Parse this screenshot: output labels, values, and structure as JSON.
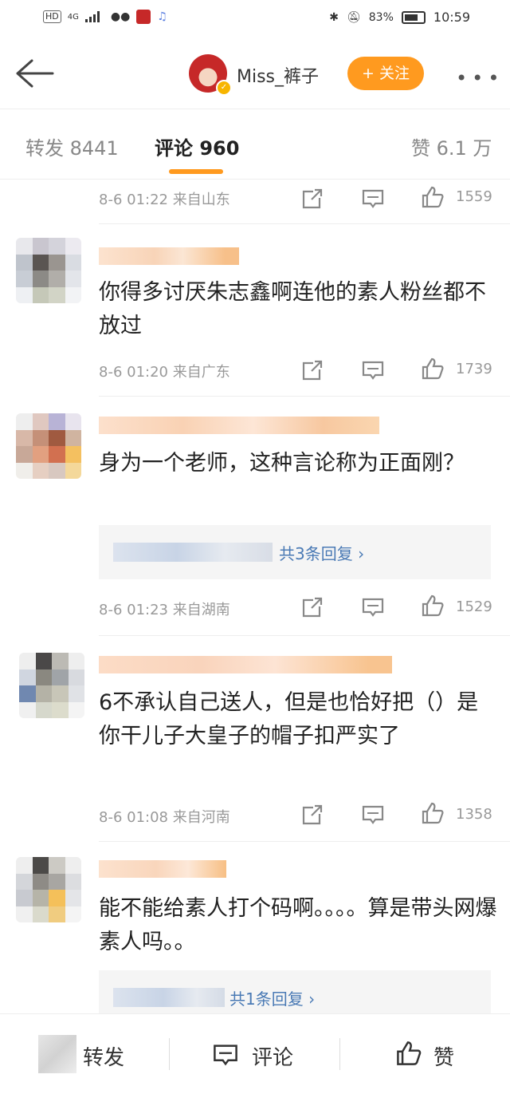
{
  "status_bar": {
    "left_items": [
      "HD",
      "4G"
    ],
    "battery": "83%",
    "time": "10:59"
  },
  "header": {
    "back_icon": "arrow-left-icon",
    "username": "Miss_裤子",
    "follow_label": "+ 关注",
    "more_icon": "more-dots-icon"
  },
  "tabs": {
    "repost": "转发 8441",
    "comments": "评论 960",
    "likes": "赞 6.1 万"
  },
  "colors": {
    "accent": "#ff9a1f",
    "link": "#4a7ab5",
    "meta": "#999999"
  },
  "comments": [
    {
      "meta": "8-6 01:22 来自山东",
      "likes": "1559"
    },
    {
      "text": "你得多讨厌朱志鑫啊连他的素人粉丝都不放过",
      "meta": "8-6 01:20 来自广东",
      "likes": "1739"
    },
    {
      "text": "身为一个老师，这种言论称为正面刚？",
      "reply_summary": "共3条回复 ›",
      "meta": "8-6 01:23 来自湖南",
      "likes": "1529"
    },
    {
      "text": "6不承认自己送人，但是也恰好把（）是你干儿子大皇子的帽子扣严实了",
      "meta": "8-6 01:08 来自河南",
      "likes": "1358"
    },
    {
      "text": "能不能给素人打个码啊。。。。算是带头网爆素人吗。。",
      "reply_summary": "共1条回复 ›"
    }
  ],
  "bottom_bar": {
    "repost": "转发",
    "comment": "评论",
    "like": "赞"
  }
}
